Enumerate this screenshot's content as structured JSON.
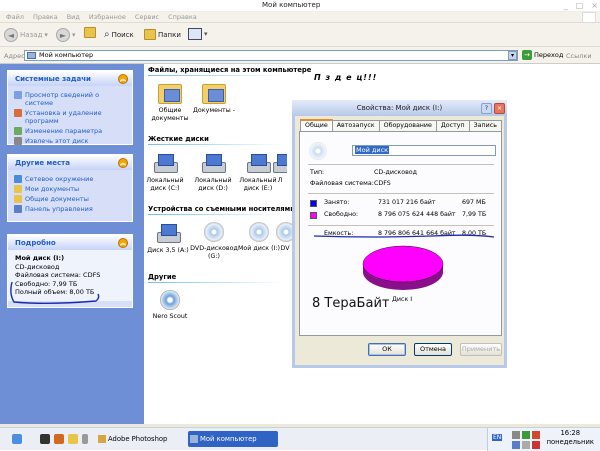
{
  "window": {
    "title": "Мой компьютер"
  },
  "menu": {
    "items": [
      "Файл",
      "Правка",
      "Вид",
      "Избранное",
      "Сервис",
      "Справка"
    ]
  },
  "toolbar": {
    "back_label": "Назад",
    "search_label": "Поиск",
    "folders_label": "Папки"
  },
  "address": {
    "label": "Адрес",
    "value": "Мой компьютер",
    "go_label": "Переход",
    "links_label": "Ссылки"
  },
  "sidebar": {
    "system_tasks": {
      "title": "Системные задачи",
      "items": [
        "Просмотр сведений о системе",
        "Установка и удаление программ",
        "Изменение параметра",
        "Извлечь этот диск"
      ]
    },
    "other_places": {
      "title": "Другие места",
      "items": [
        "Сетевое окружение",
        "Мои документы",
        "Общие документы",
        "Панель управления"
      ]
    },
    "details": {
      "title": "Подробно",
      "name": "Мой диск (I:)",
      "type": "CD-дисковод",
      "fs": "Файловая система: CDFS",
      "free": "Свободно: 7,99 ТБ",
      "total": "Полный объем: 8,00 ТБ"
    }
  },
  "main": {
    "section_files": "Файлы, хранящиеся на этом компьютере",
    "files_items": [
      "Общие документы",
      "Документы -"
    ],
    "section_hdd": "Жесткие диски",
    "hdd_items": [
      "Локальный диск (C:)",
      "Локальный диск (D:)",
      "Локальный диск (E:)",
      "Л"
    ],
    "section_removable": "Устройства со съемными носителями",
    "removable_items": [
      "Диск 3,5 (A:)",
      "DVD-дисковод (G:)",
      "Мой диск (I:)",
      "DV"
    ],
    "section_other": "Другие",
    "other_items": [
      "Nero Scout"
    ]
  },
  "annotation": {
    "text": "П з д е ц!!!"
  },
  "dialog": {
    "title": "Свойства: Мой диск (I:)",
    "tabs": [
      "Общие",
      "Автозапуск",
      "Оборудование",
      "Доступ",
      "Запись"
    ],
    "disk_name": "Мой диск",
    "type_label": "Тип:",
    "type_value": "CD-дисковод",
    "fs_label": "Файловая система:",
    "fs_value": "CDFS",
    "used_label": "Занято:",
    "used_bytes": "731 017 216 байт",
    "used_size": "697 МБ",
    "free_label": "Свободно:",
    "free_bytes": "8 796 075 624 448 байт",
    "free_size": "7,99 ТБ",
    "cap_label": "Емкость:",
    "cap_bytes": "8 796 806 641 664 байт",
    "cap_size": "8,00 ТБ",
    "pie_label": "Диск I",
    "ok_label": "ОК",
    "cancel_label": "Отмена",
    "apply_label": "Применить",
    "used_color": "#0000ff",
    "free_color": "#ff00ff"
  },
  "caption": {
    "text": "8 ТераБайт"
  },
  "taskbar": {
    "items": [
      "Adobe Photoshop",
      "Мой компьютер"
    ],
    "tray_lang": "EN",
    "clock_time": "16:28",
    "clock_day": "понедельник"
  }
}
